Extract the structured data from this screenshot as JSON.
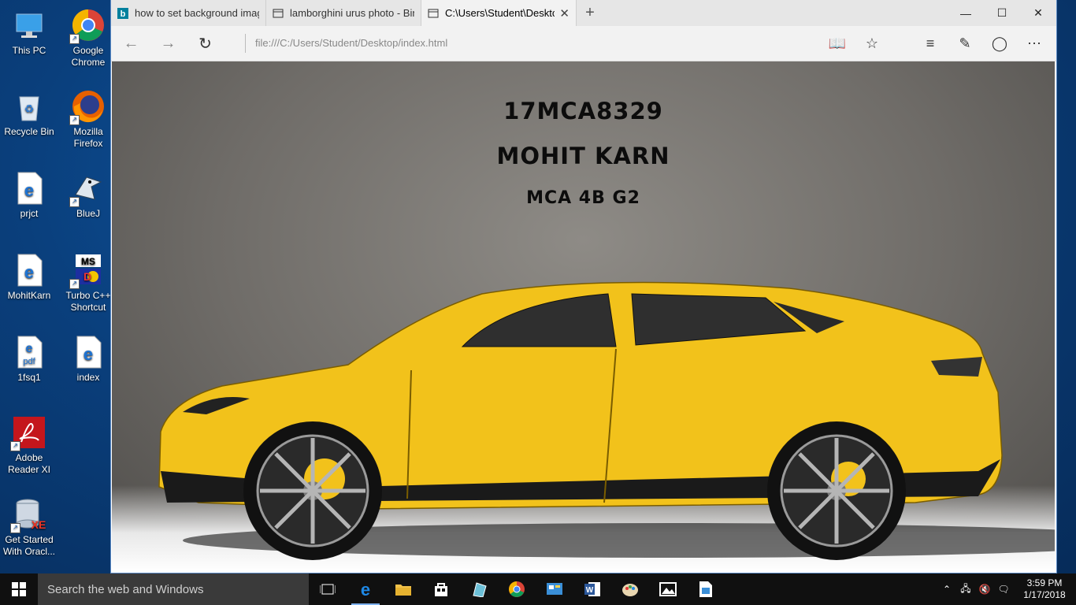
{
  "desktop": {
    "icons": [
      {
        "label": "This PC"
      },
      {
        "label": "Google\nChrome"
      },
      {
        "label": "Recycle Bin"
      },
      {
        "label": "Mozilla\nFirefox"
      },
      {
        "label": "prjct"
      },
      {
        "label": "BlueJ"
      },
      {
        "label": "MohitKarn"
      },
      {
        "label": "Turbo C++\nShortcut"
      },
      {
        "label": "1fsq1"
      },
      {
        "label": "index"
      },
      {
        "label": "Adobe\nReader XI"
      },
      {
        "label": "Get Started\nWith Oracl..."
      }
    ]
  },
  "browser": {
    "tabs": [
      {
        "label": "how to set background imag",
        "icon": "bing-icon",
        "active": false
      },
      {
        "label": "lamborghini urus photo - Bin",
        "icon": "page-icon",
        "active": false
      },
      {
        "label": "C:\\Users\\Student\\Desktc",
        "icon": "page-icon",
        "active": true
      }
    ],
    "address": "file:///C:/Users/Student/Desktop/index.html"
  },
  "page": {
    "line1": "17MCA8329",
    "line2": "MOHIT KARN",
    "line3": "MCA 4B G2",
    "car_color": "#f2c21b"
  },
  "taskbar": {
    "search_placeholder": "Search the web and Windows",
    "time": "3:59 PM",
    "date": "1/17/2018"
  }
}
